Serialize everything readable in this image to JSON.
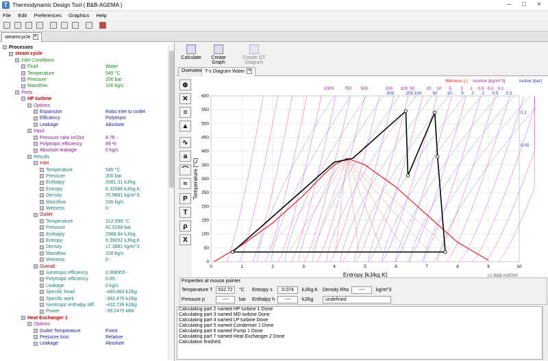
{
  "window": {
    "title": "Thermodynamic Design Tool ( B&B-AGEMA )"
  },
  "menu": [
    "File",
    "Edit",
    "Preferences",
    "Graphics",
    "Help"
  ],
  "doc_tab": "steamcycle",
  "right_toolbar": [
    "Calculate",
    "Create Graph",
    "Create QT Diagram"
  ],
  "content_tabs": [
    "Overview",
    "T-s Diagram Water"
  ],
  "tree": [
    {
      "d": 0,
      "t": "Processes",
      "c": "",
      "b": true
    },
    {
      "d": 1,
      "t": "steam cycle",
      "c": "red",
      "b": true
    },
    {
      "d": 2,
      "t": "Inlet Conditions",
      "c": "green",
      "i": true
    },
    {
      "d": 3,
      "t": "Fluid",
      "c": "green",
      "v": "Water"
    },
    {
      "d": 3,
      "t": "Temperature",
      "c": "green",
      "v": "545 °C"
    },
    {
      "d": 3,
      "t": "Pressure",
      "c": "green",
      "v": "200 bar"
    },
    {
      "d": 3,
      "t": "Massflow",
      "c": "green",
      "v": "100 kg/s"
    },
    {
      "d": 2,
      "t": "Ports",
      "c": "purple",
      "i": true
    },
    {
      "d": 3,
      "t": "HP turbine",
      "c": "red",
      "b": true
    },
    {
      "d": 4,
      "t": "Options",
      "c": "purple",
      "i": true
    },
    {
      "d": 5,
      "t": "Expansion",
      "c": "blue",
      "v": "Ratio inlet to outlet"
    },
    {
      "d": 5,
      "t": "Efficiency",
      "c": "blue",
      "v": "Polytropic"
    },
    {
      "d": 5,
      "t": "Leakage",
      "c": "blue",
      "v": "Absolute"
    },
    {
      "d": 4,
      "t": "Input",
      "c": "purple",
      "i": true
    },
    {
      "d": 5,
      "t": "Pressure ratio In/Out",
      "c": "purple",
      "v": "4.76 -"
    },
    {
      "d": 5,
      "t": "Polytropic efficiency",
      "c": "purple",
      "v": "89 %"
    },
    {
      "d": 5,
      "t": "Absolute leakage",
      "c": "purple",
      "v": "0 kg/s"
    },
    {
      "d": 4,
      "t": "Results",
      "c": "teal",
      "i": true
    },
    {
      "d": 5,
      "t": "Inlet",
      "c": "red"
    },
    {
      "d": 6,
      "t": "Temperature",
      "c": "teal",
      "v": "545 °C"
    },
    {
      "d": 6,
      "t": "Pressure",
      "c": "teal",
      "v": "200 bar"
    },
    {
      "d": 6,
      "t": "Enthalpy",
      "c": "teal",
      "v": "3381.31 kJ/kg"
    },
    {
      "d": 6,
      "t": "Entropy",
      "c": "teal",
      "v": "6.32086 kJ/kg.K"
    },
    {
      "d": 6,
      "t": "Density",
      "c": "teal",
      "v": "70.9681 kg/m^3"
    },
    {
      "d": 6,
      "t": "Massflow",
      "c": "teal",
      "v": "100 kg/s"
    },
    {
      "d": 6,
      "t": "Wetness",
      "c": "teal",
      "v": "0 -"
    },
    {
      "d": 5,
      "t": "Outlet",
      "c": "red"
    },
    {
      "d": 6,
      "t": "Temperature",
      "c": "teal",
      "v": "312.098 °C"
    },
    {
      "d": 6,
      "t": "Pressure",
      "c": "teal",
      "v": "42.0168 bar"
    },
    {
      "d": 6,
      "t": "Enthalpy",
      "c": "teal",
      "v": "2988.84 kJ/kg"
    },
    {
      "d": 6,
      "t": "Entropy",
      "c": "teal",
      "v": "6.39052 kJ/kg.K"
    },
    {
      "d": 6,
      "t": "Density",
      "c": "teal",
      "v": "17.3881 kg/m^3"
    },
    {
      "d": 6,
      "t": "Massflow",
      "c": "teal",
      "v": "100 kg/s"
    },
    {
      "d": 6,
      "t": "Wetness",
      "c": "teal",
      "v": "0 -"
    },
    {
      "d": 5,
      "t": "Overall",
      "c": "red"
    },
    {
      "d": 6,
      "t": "Isentropic efficiency",
      "c": "teal",
      "v": "0.906955 -"
    },
    {
      "d": 6,
      "t": "Polytropic efficiency",
      "c": "teal",
      "v": "0.89 -"
    },
    {
      "d": 6,
      "t": "Leakage",
      "c": "teal",
      "v": "0 kg/s"
    },
    {
      "d": 6,
      "t": "Specific head",
      "c": "teal",
      "v": "-440.883 kJ/kg"
    },
    {
      "d": 6,
      "t": "Specific work",
      "c": "teal",
      "v": "-392.475 kJ/kg"
    },
    {
      "d": 6,
      "t": "Isentropic enthalpy diff.",
      "c": "teal",
      "v": "-432.739 kJ/kg"
    },
    {
      "d": 6,
      "t": "Power",
      "c": "teal",
      "v": "-39.2475 MW"
    },
    {
      "d": 3,
      "t": "Heat Exchanger 1",
      "c": "red",
      "b": true
    },
    {
      "d": 4,
      "t": "Options",
      "c": "purple",
      "i": true
    },
    {
      "d": 5,
      "t": "Outlet Temperature",
      "c": "blue",
      "v": "Fixed"
    },
    {
      "d": 5,
      "t": "Pressure loss",
      "c": "blue",
      "v": "Relative"
    },
    {
      "d": 5,
      "t": "Leakage",
      "c": "blue",
      "v": "Absolute"
    }
  ],
  "properties": {
    "title": "Properties at mouse pointer",
    "temperature_label": "Temperature T",
    "temperature_value": "532.72",
    "temperature_unit": "°C",
    "entropy_label": "Entropy s",
    "entropy_value": "0.074",
    "entropy_unit": "kJ/kg.K",
    "density_label": "Density Rho",
    "density_value": "----",
    "density_unit": "kg/m^3",
    "pressure_label": "Pressure p",
    "pressure_value": "----",
    "pressure_unit": "bar",
    "enthalpy_label": "Enthalpy h",
    "enthalpy_value": "----",
    "enthalpy_unit": "kJ/kg",
    "state_value": "undefined"
  },
  "log": [
    "Calculating part 2 named HP turbine 1  Done",
    "Calculating part 3 named MD turbine  Done",
    "Calculating part 4 named LP turbine  Done",
    "Calculating part 5 named Condenser 1  Done",
    "Calculating part 6 named Pump 1  Done",
    "Calculating part 7 named Heat Exchanger 2  Done",
    "Calculation finished."
  ],
  "chart_data": {
    "type": "line",
    "xlabel": "Entropy [kJ/kg.K]",
    "ylabel": "Temperature [°C]",
    "xlim": [
      0,
      10
    ],
    "ylim": [
      0,
      600
    ],
    "xticks": [
      0,
      1,
      2,
      3,
      4,
      5,
      6,
      7,
      8,
      9,
      10
    ],
    "yticks": [
      0,
      50,
      100,
      150,
      200,
      250,
      300,
      350,
      400,
      450,
      500,
      550,
      600
    ],
    "legend_wetness": "Wetness [-]",
    "legend_isochor": "Isochor [kg/m^3]",
    "legend_isobar": "Isobar [bar]",
    "isochor_labels_top": [
      "1000",
      "750",
      "500",
      "200",
      "100",
      "50",
      "20",
      "10",
      "5",
      "2",
      "1",
      "0.5",
      "0.2",
      "0.1"
    ],
    "isochor_labels_row2": [
      "500",
      "200",
      "100",
      "50",
      "10",
      "5",
      "2",
      "1",
      "0.5",
      "0.2"
    ],
    "isobar_labels_right": [
      "0.1",
      "0.05"
    ],
    "copyright": "(c) B&B-AGEMA",
    "saturation_dome": {
      "s": [
        0.1,
        1.0,
        2.0,
        3.0,
        3.7,
        4.0,
        4.41,
        5.0,
        6.0,
        7.0,
        8.0,
        9.0
      ],
      "T": [
        0,
        60,
        140,
        240,
        320,
        350,
        374,
        350,
        270,
        170,
        70,
        5
      ]
    },
    "cycle": {
      "s": [
        0.7,
        4.0,
        4.6,
        6.32,
        6.39,
        7.26,
        7.35,
        7.6,
        0.7
      ],
      "T": [
        35,
        360,
        374,
        545,
        312,
        540,
        380,
        35,
        35
      ]
    },
    "cycle_points": {
      "s": [
        0.7,
        6.32,
        6.39,
        7.26,
        7.35,
        7.6
      ],
      "T": [
        35,
        545,
        312,
        540,
        380,
        35
      ]
    }
  }
}
